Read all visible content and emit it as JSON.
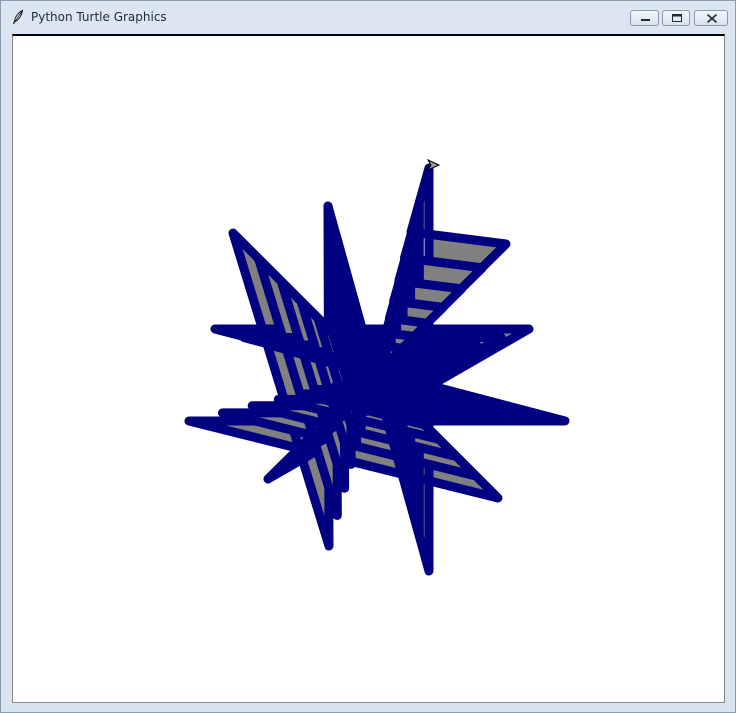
{
  "window": {
    "title": "Python Turtle Graphics",
    "app_icon": "feather-icon",
    "controls": {
      "minimize_icon": "minimize-icon",
      "maximize_icon": "maximize-icon",
      "close_icon": "close-icon"
    }
  },
  "canvas": {
    "background": "#ffffff",
    "pen_color": "#000080",
    "fill_color": "#808080",
    "turtle_icon": "turtle-arrow-icon"
  }
}
